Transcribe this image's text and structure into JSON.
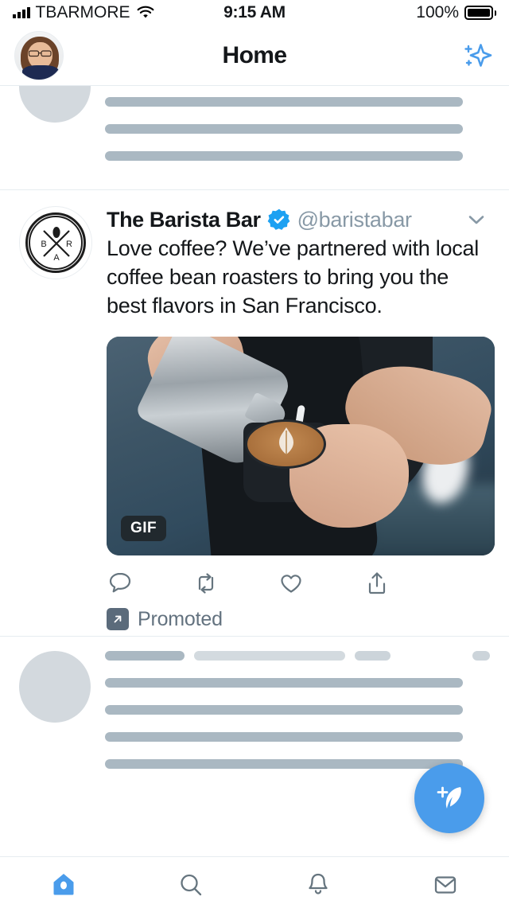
{
  "status_bar": {
    "carrier": "TBARMORE",
    "time": "9:15 AM",
    "battery_percent": "100%",
    "signal_icon": "signal-bars-icon",
    "wifi_icon": "wifi-icon",
    "battery_icon": "battery-full-icon"
  },
  "header": {
    "title": "Home",
    "avatar_icon": "profile-avatar",
    "sparkle_icon": "sparkle-icon"
  },
  "tweet": {
    "display_name": "The Barista Bar",
    "handle": "@baristabar",
    "verified_icon": "verified-badge-icon",
    "caret_icon": "chevron-down-icon",
    "text": "Love coffee? We’ve partnered with local coffee bean roasters to bring you the best flavors in San Francisco.",
    "avatar_icon": "barista-bar-logo",
    "media": {
      "badge": "GIF",
      "alt": "barista pouring steamed milk latte art into a cup"
    },
    "actions": [
      {
        "name": "reply-icon",
        "label": "Reply"
      },
      {
        "name": "retweet-icon",
        "label": "Retweet"
      },
      {
        "name": "like-icon",
        "label": "Like"
      },
      {
        "name": "share-icon",
        "label": "Share"
      }
    ],
    "promoted_label": "Promoted",
    "promoted_icon": "promoted-arrow-icon"
  },
  "compose": {
    "icon": "compose-feather-icon",
    "label": "Compose Tweet"
  },
  "tabbar": {
    "items": [
      {
        "name": "tab-home",
        "icon": "home-icon",
        "label": "Home",
        "active": true
      },
      {
        "name": "tab-search",
        "icon": "search-icon",
        "label": "Search",
        "active": false
      },
      {
        "name": "tab-notifications",
        "icon": "bell-icon",
        "label": "Notifications",
        "active": false
      },
      {
        "name": "tab-messages",
        "icon": "envelope-icon",
        "label": "Messages",
        "active": false
      }
    ]
  },
  "skeletons": {
    "top": {
      "lines": [
        450,
        450,
        450
      ],
      "dots": 4
    },
    "bottom": {
      "header_chips": [
        100,
        190,
        45,
        20
      ],
      "lines": [
        450,
        450,
        450,
        450
      ],
      "dots": 4
    }
  },
  "colors": {
    "accent": "#4a9ceb",
    "verified": "#1da1f2",
    "muted_text": "#8899a6",
    "promoted_text": "#63727f",
    "icon_gray": "#66757f",
    "divider": "#e6ecf0",
    "skeleton_dark": "#aab8c2",
    "skeleton_light": "#cfd6dc"
  }
}
